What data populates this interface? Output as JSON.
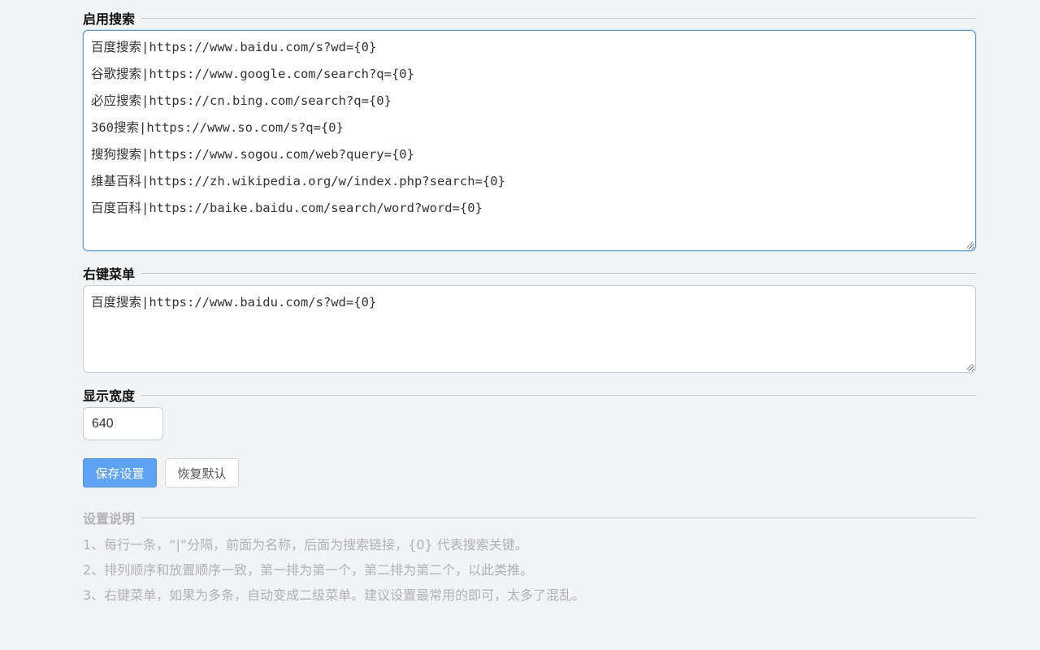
{
  "sections": {
    "enabled_search": {
      "title": "启用搜索",
      "lines": [
        "百度搜索|https://www.baidu.com/s?wd={0}",
        "谷歌搜索|https://www.google.com/search?q={0}",
        "必应搜索|https://cn.bing.com/search?q={0}",
        "360搜索|https://www.so.com/s?q={0}",
        "搜狗搜索|https://www.sogou.com/web?query={0}",
        "维基百科|https://zh.wikipedia.org/w/index.php?search={0}",
        "百度百科|https://baike.baidu.com/search/word?word={0}"
      ]
    },
    "context_menu": {
      "title": "右键菜单",
      "lines": [
        "百度搜索|https://www.baidu.com/s?wd={0}"
      ]
    },
    "display_width": {
      "title": "显示宽度",
      "value": "640"
    }
  },
  "buttons": {
    "save_label": "保存设置",
    "reset_label": "恢复默认"
  },
  "help": {
    "title": "设置说明",
    "notes": [
      "1、每行一条，“|”分隔，前面为名称，后面为搜索链接，{0} 代表搜索关键。",
      "2、排列顺序和放置顺序一致，第一排为第一个，第二排为第二个，以此类推。",
      "3、右键菜单，如果为多条，自动变成二级菜单。建议设置最常用的即可，太多了混乱。"
    ]
  },
  "colors": {
    "background": "#f2f3f5",
    "primary_button": "#5fa3f5",
    "focus_border": "#5b9de8",
    "muted_text": "#b2b2b6"
  }
}
